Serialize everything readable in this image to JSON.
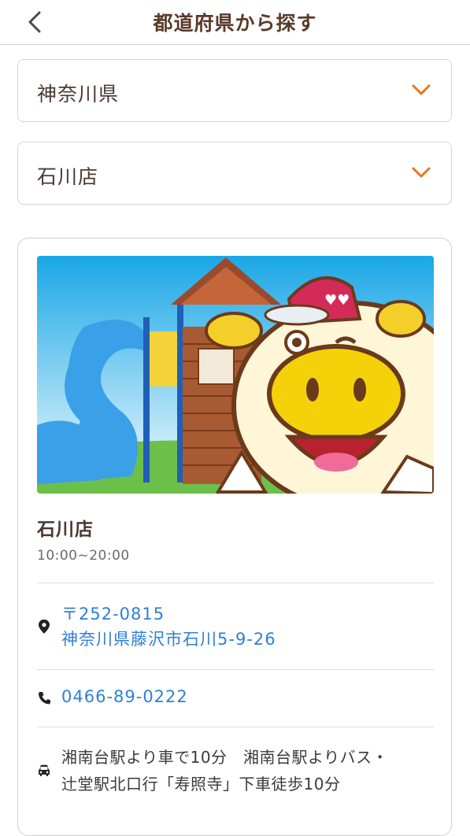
{
  "header": {
    "title": "都道府県から探す"
  },
  "filters": {
    "prefecture": "神奈川県",
    "store": "石川店"
  },
  "store": {
    "name": "石川店",
    "hours": "10:00~20:00",
    "postal": "〒252-0815",
    "address": "神奈川県藤沢市石川5-9-26",
    "phone": "0466-89-0222",
    "access_line1": "湘南台駅より車で10分　湘南台駅よりバス・",
    "access_line2": "辻堂駅北口行「寿照寺」下車徒歩10分"
  },
  "colors": {
    "accent": "#e8761d",
    "link": "#2f7fd6",
    "title_brown": "#5a3a2a"
  },
  "icons": [
    "back-arrow-icon",
    "chevron-down-icon",
    "location-pin-icon",
    "phone-icon",
    "car-icon"
  ]
}
